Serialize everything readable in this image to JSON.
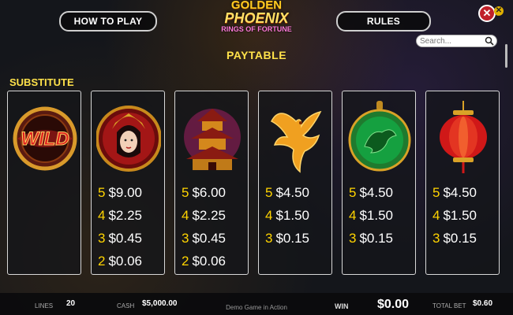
{
  "header": {
    "how_to_play_label": "HOW TO PLAY",
    "rules_label": "RULES",
    "logo_line1": "GOLDEN",
    "logo_line2": "PHOENIX",
    "logo_line3": "RINGS OF FORTUNE",
    "close_glyph": "✕",
    "close2_glyph": "✕",
    "search_placeholder": "Search..."
  },
  "paytable": {
    "title": "PAYTABLE",
    "substitute_label": "SUBSTITUTE",
    "cards": [
      {
        "symbol": "wild-symbol",
        "wild_text": "WILD",
        "pays": []
      },
      {
        "symbol": "empress-symbol",
        "pays": [
          {
            "count": "5",
            "amount": "$9.00"
          },
          {
            "count": "4",
            "amount": "$2.25"
          },
          {
            "count": "3",
            "amount": "$0.45"
          },
          {
            "count": "2",
            "amount": "$0.06"
          }
        ]
      },
      {
        "symbol": "pagoda-symbol",
        "pays": [
          {
            "count": "5",
            "amount": "$6.00"
          },
          {
            "count": "4",
            "amount": "$2.25"
          },
          {
            "count": "3",
            "amount": "$0.45"
          },
          {
            "count": "2",
            "amount": "$0.06"
          }
        ]
      },
      {
        "symbol": "phoenix-symbol",
        "pays": [
          {
            "count": "5",
            "amount": "$4.50"
          },
          {
            "count": "4",
            "amount": "$1.50"
          },
          {
            "count": "3",
            "amount": "$0.15"
          }
        ]
      },
      {
        "symbol": "jade-dragon-symbol",
        "pays": [
          {
            "count": "5",
            "amount": "$4.50"
          },
          {
            "count": "4",
            "amount": "$1.50"
          },
          {
            "count": "3",
            "amount": "$0.15"
          }
        ]
      },
      {
        "symbol": "lantern-symbol",
        "pays": [
          {
            "count": "5",
            "amount": "$4.50"
          },
          {
            "count": "4",
            "amount": "$1.50"
          },
          {
            "count": "3",
            "amount": "$0.15"
          }
        ]
      }
    ]
  },
  "footer": {
    "lines_label": "LINES",
    "lines_value": "20",
    "cash_label": "CASH",
    "cash_value": "$5,000.00",
    "demo_text": "Demo Game in Action",
    "win_label": "WIN",
    "win_value": "$0.00",
    "total_bet_label": "TOTAL BET",
    "total_bet_value": "$0.60"
  },
  "colors": {
    "accent_yellow": "#ffe24a",
    "count_yellow": "#ffd400",
    "close_red": "#c0202a"
  }
}
